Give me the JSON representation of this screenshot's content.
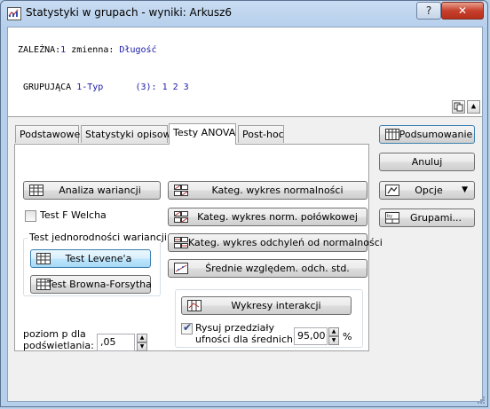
{
  "window": {
    "title": "Statystyki w grupach - wyniki: Arkusz6",
    "help_label": "?",
    "close_label": "✕"
  },
  "variables": {
    "dependent_label": "ZALEŻNA:",
    "dependent_count": "1",
    "dependent_word": " zmienna:",
    "dependent_name": "Długość",
    "grouping_label": "GRUPUJĄCA",
    "grouping_num": "1",
    "grouping_name": "-Typ",
    "grouping_levels": "(3): 1 2 3"
  },
  "tabs": [
    {
      "label": "Podstawowe",
      "active": false
    },
    {
      "label": "Statystyki opisowe",
      "active": false
    },
    {
      "label": "Testy ANOVA",
      "active": true
    },
    {
      "label": "Post-hoc",
      "active": false
    }
  ],
  "anova": {
    "analiza_wariancji": "Analiza wariancji",
    "test_f_welcha": "Test F Welcha",
    "homogeneity_group_title": "Test jednorodności wariancji",
    "test_levene": "Test Levene'a",
    "test_browna_forsytha": "Test Browna-Forsytha",
    "wykres_normalnosci": "Kateg. wykres normalności",
    "wykres_polowkowej": "Kateg. wykres norm. połówkowej",
    "wykres_odchylen": "Kateg. wykres odchyleń od normalności",
    "srednie_wzgledem": "Średnie względem. odch. std.",
    "wykresy_interakcji": "Wykresy interakcji",
    "rysuj_przedzialy_line1": "Rysuj przedziały",
    "rysuj_przedzialy_line2": "ufności dla średnich",
    "rysuj_checked": true,
    "confidence_value": "95,00",
    "percent_label": "%",
    "p_level_line1": "poziom p dla",
    "p_level_line2": "podświetlania:",
    "p_level_value": ",05"
  },
  "side_buttons": {
    "podsumowanie": "Podsumowanie",
    "anuluj": "Anuluj",
    "opcje": "Opcje",
    "grupami": "Grupami..."
  },
  "colors": {
    "variable_blue": "#1a1aa6",
    "window_frame": "#b9d1ea"
  }
}
